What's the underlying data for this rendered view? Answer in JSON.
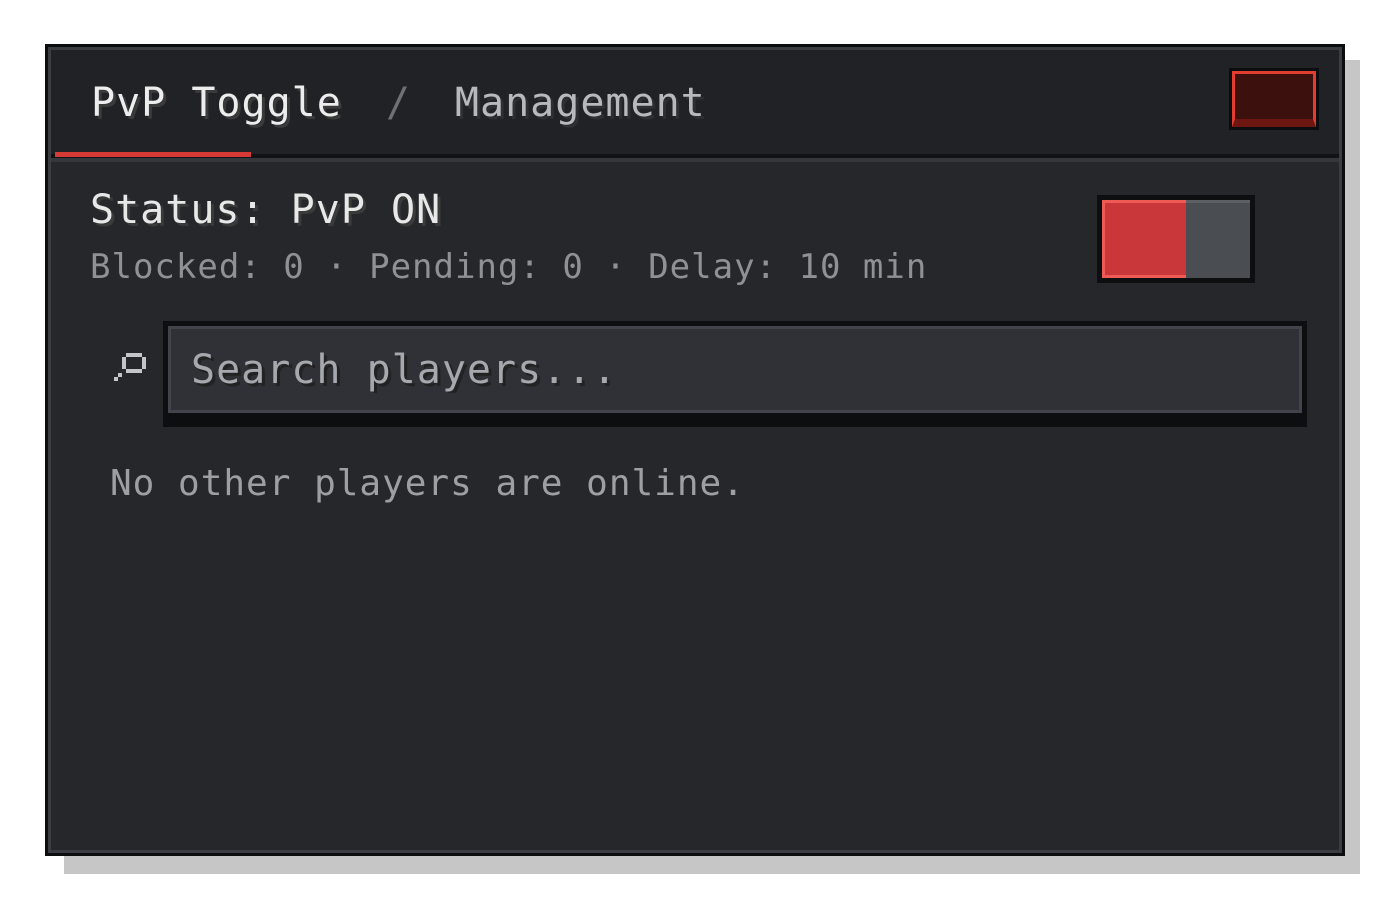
{
  "header": {
    "active_tab": "PvP Toggle",
    "separator": "/",
    "inactive_tab": "Management",
    "close_icon": "close-icon"
  },
  "status": {
    "title": "Status: PvP ON",
    "details": "Blocked: 0 · Pending: 0 · Delay: 10 min",
    "pvp_enabled": true
  },
  "search": {
    "placeholder": "Search players...",
    "value": "",
    "icon": "search-icon"
  },
  "players": {
    "empty_message": "No other players are online."
  },
  "colors": {
    "accent": "#d63a35",
    "toggle_on": "#c9373a",
    "panel_bg": "#25272b"
  }
}
